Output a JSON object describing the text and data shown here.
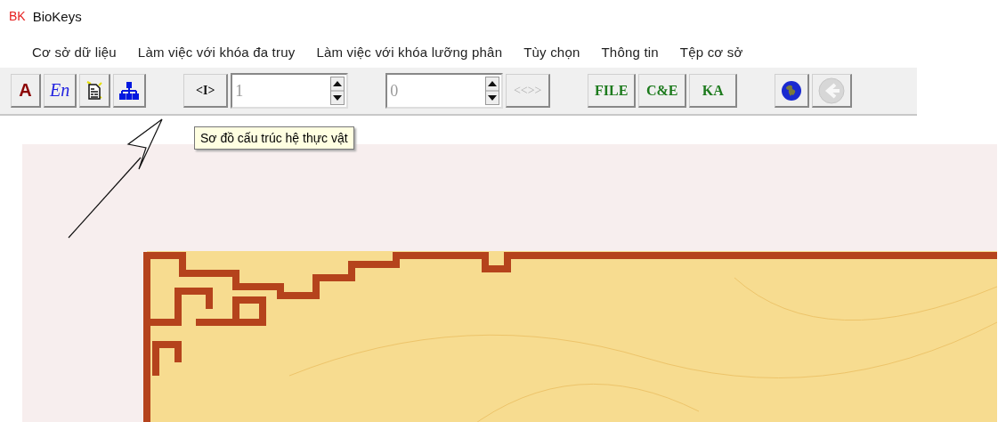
{
  "app": {
    "logo": "BK",
    "title": "BioKeys"
  },
  "menu": [
    {
      "label": "Cơ sở dữ liệu"
    },
    {
      "label": "Làm việc với khóa đa truy"
    },
    {
      "label": "Làm việc với khóa lưỡng phân"
    },
    {
      "label": "Tùy chọn"
    },
    {
      "label": "Thông tin"
    },
    {
      "label": "Tệp cơ sở"
    }
  ],
  "toolbar": [
    [
      {
        "kind": "letter",
        "label": "A",
        "disabled": false
      },
      {
        "kind": "italic",
        "label": "En",
        "disabled": false
      },
      {
        "kind": "document",
        "disabled": false
      },
      {
        "kind": "tree",
        "disabled": false
      }
    ],
    [
      {
        "kind": "bracket",
        "label": "<I>",
        "disabled": false
      },
      {
        "kind": "spinner",
        "value": "1",
        "disabled": false
      }
    ],
    [
      {
        "kind": "spinner",
        "value": "0",
        "disabled": false
      },
      {
        "kind": "bracket",
        "label": "<<>>",
        "disabled": true
      }
    ],
    [
      {
        "kind": "green",
        "label": "FILE",
        "disabled": false
      },
      {
        "kind": "green",
        "label": "C&E",
        "disabled": false
      },
      {
        "kind": "green",
        "label": "KA",
        "disabled": false
      }
    ],
    [
      {
        "kind": "globe",
        "disabled": false
      },
      {
        "kind": "back",
        "disabled": true
      }
    ]
  ],
  "tooltip": {
    "text": "Sơ đồ cấu trúc hệ thực vật"
  }
}
